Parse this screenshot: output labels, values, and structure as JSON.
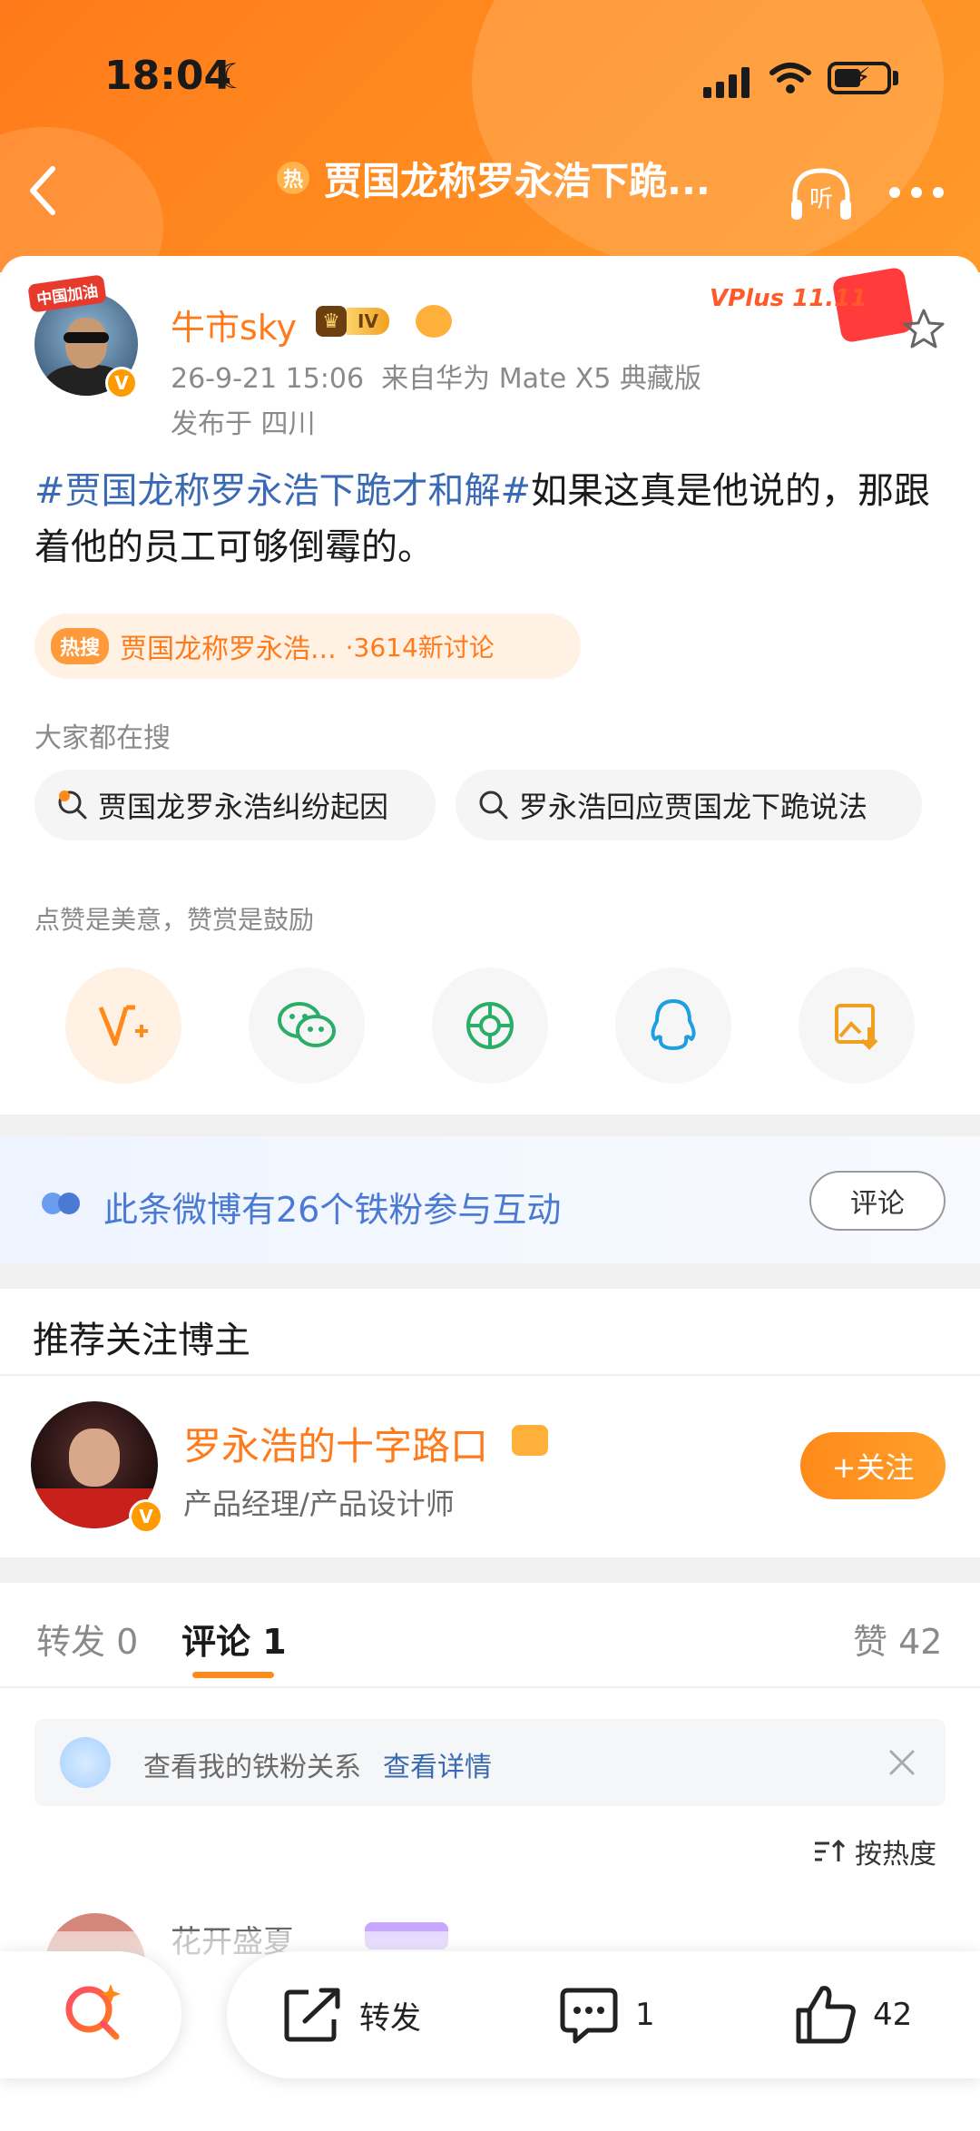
{
  "status_bar": {
    "time": "18:04"
  },
  "nav": {
    "title": "贾国龙称罗永浩下跪...",
    "hot_badge": "热",
    "listen_label": "听"
  },
  "post": {
    "avatar_tag": "中国加油",
    "username": "牛市sky",
    "level": "IV",
    "timestamp": "26-9-21 15:06",
    "source": "来自华为 Mate X5 典藏版",
    "location": "发布于 四川",
    "vplus": "VPlus 11.11",
    "topic": "#贾国龙称罗永浩下跪才和解#",
    "body": "如果这真是他说的，那跟着他的员工可够倒霉的。",
    "hot_tag": "热搜",
    "hot_title": "贾国龙称罗永浩...",
    "hot_count": "·3614新讨论",
    "search_label": "大家都在搜",
    "suggestions": [
      "贾国龙罗永浩纠纷起因",
      "罗永浩回应贾国龙下跪说法"
    ],
    "like_tip": "点赞是美意，赞赏是鼓励",
    "share_icons": [
      "vplus-reward-icon",
      "wechat-icon",
      "moments-icon",
      "qq-icon",
      "save-image-icon"
    ]
  },
  "fans_strip": {
    "text": "此条微博有26个铁粉参与互动",
    "button": "评论"
  },
  "recommend": {
    "title": "推荐关注博主",
    "name": "罗永浩的十字路口",
    "desc": "产品经理/产品设计师",
    "follow": "+关注"
  },
  "comments": {
    "tabs": [
      {
        "label": "转发",
        "count": "0"
      },
      {
        "label": "评论",
        "count": "1"
      }
    ],
    "likes_label": "赞 42",
    "fan_banner_text": "查看我的铁粉关系",
    "fan_banner_link": "查看详情",
    "sort_label": "按热度",
    "peek_name": "花开盛夏"
  },
  "bottom_bar": {
    "repost": "转发",
    "comment_count": "1",
    "like_count": "42"
  },
  "colors": {
    "accent": "#ff7a1a",
    "link": "#3a6ab4",
    "header": "#ff8a1f"
  }
}
